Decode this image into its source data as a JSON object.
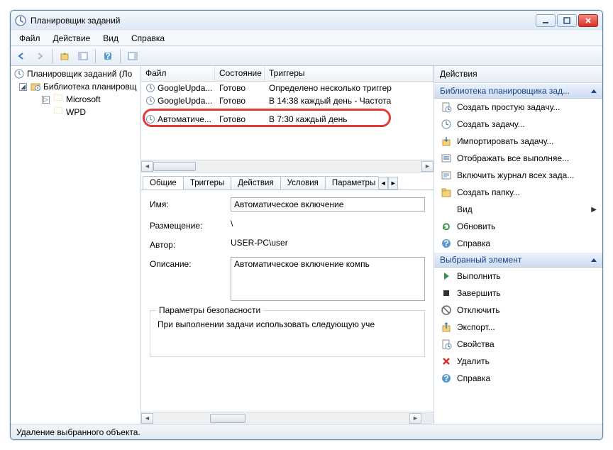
{
  "window": {
    "title": "Планировщик заданий"
  },
  "menu": {
    "file": "Файл",
    "action": "Действие",
    "view": "Вид",
    "help": "Справка"
  },
  "tree": {
    "root": "Планировщик заданий (Ло",
    "library": "Библиотека планировщ",
    "microsoft": "Microsoft",
    "wpd": "WPD"
  },
  "list": {
    "headers": {
      "file": "Файл",
      "state": "Состояние",
      "triggers": "Триггеры"
    },
    "rows": [
      {
        "name": "GoogleUpda...",
        "state": "Готово",
        "trigger": "Определено несколько триггер"
      },
      {
        "name": "GoogleUpda...",
        "state": "Готово",
        "trigger": "В 14:38 каждый день - Частота"
      },
      {
        "name": "Автоматиче...",
        "state": "Готово",
        "trigger": "В 7:30 каждый день"
      }
    ]
  },
  "tabs": {
    "general": "Общие",
    "triggers": "Триггеры",
    "actions": "Действия",
    "conditions": "Условия",
    "settings": "Параметры"
  },
  "detail": {
    "name_label": "Имя:",
    "name_value": "Автоматическое включение",
    "location_label": "Размещение:",
    "location_value": "\\",
    "author_label": "Автор:",
    "author_value": "USER-PC\\user",
    "description_label": "Описание:",
    "description_value": "Автоматическое включение компь",
    "security_group": "Параметры безопасности",
    "security_text": "При выполнении задачи использовать следующую уче"
  },
  "actions": {
    "title": "Действия",
    "section1": "Библиотека планировщика зад...",
    "items1": [
      {
        "icon": "new-basic",
        "label": "Создать простую задачу..."
      },
      {
        "icon": "new",
        "label": "Создать задачу..."
      },
      {
        "icon": "import",
        "label": "Импортировать задачу..."
      },
      {
        "icon": "show-running",
        "label": "Отображать все выполняе..."
      },
      {
        "icon": "enable-history",
        "label": "Включить журнал всех зада..."
      },
      {
        "icon": "new-folder",
        "label": "Создать папку..."
      },
      {
        "icon": "view",
        "label": "Вид",
        "has_arrow": true
      },
      {
        "icon": "refresh",
        "label": "Обновить"
      },
      {
        "icon": "help",
        "label": "Справка"
      }
    ],
    "section2": "Выбранный элемент",
    "items2": [
      {
        "icon": "run",
        "label": "Выполнить"
      },
      {
        "icon": "end",
        "label": "Завершить"
      },
      {
        "icon": "disable",
        "label": "Отключить"
      },
      {
        "icon": "export",
        "label": "Экспорт..."
      },
      {
        "icon": "properties",
        "label": "Свойства"
      },
      {
        "icon": "delete",
        "label": "Удалить"
      },
      {
        "icon": "help",
        "label": "Справка"
      }
    ]
  },
  "statusbar": {
    "text": "Удаление выбранного объекта."
  }
}
